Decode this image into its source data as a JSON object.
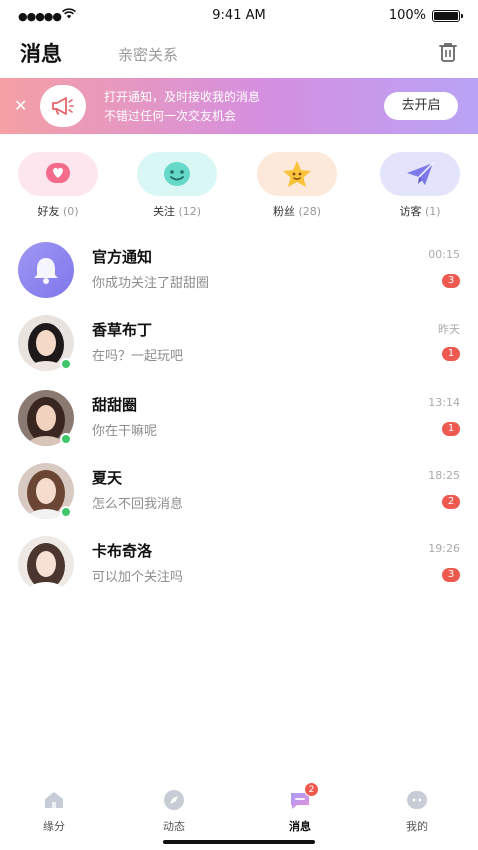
{
  "status_bar": {
    "time": "9:41 AM",
    "battery": "100%"
  },
  "header": {
    "active_tab": "消息",
    "inactive_tab": "亲密关系"
  },
  "banner": {
    "line1": "打开通知，及时接收我的消息",
    "line2": "不错过任何一次交友机会",
    "button": "去开启"
  },
  "shortcuts": [
    {
      "label": "好友",
      "count": "(0)",
      "icon": "heart-icon",
      "bg": "#fde6ee"
    },
    {
      "label": "关注",
      "count": "(12)",
      "icon": "smiley-icon",
      "bg": "#d8f7f5"
    },
    {
      "label": "粉丝",
      "count": "(28)",
      "icon": "star-icon",
      "bg": "#fde9d9"
    },
    {
      "label": "访客",
      "count": "(1)",
      "icon": "paper-plane-icon",
      "bg": "#e3e3fb"
    }
  ],
  "conversations": [
    {
      "name": "官方通知",
      "preview": "你成功关注了甜甜圈",
      "time": "00:15",
      "badge": "3",
      "online": false,
      "avatar": "bell-icon"
    },
    {
      "name": "香草布丁",
      "preview": "在吗？一起玩吧",
      "time": "昨天",
      "badge": "1",
      "online": true,
      "avatar": "user-photo"
    },
    {
      "name": "甜甜圈",
      "preview": "你在干嘛呢",
      "time": "13:14",
      "badge": "1",
      "online": true,
      "avatar": "user-photo"
    },
    {
      "name": "夏天",
      "preview": "怎么不回我消息",
      "time": "18:25",
      "badge": "2",
      "online": true,
      "avatar": "user-photo"
    },
    {
      "name": "卡布奇洛",
      "preview": "可以加个关注吗",
      "time": "19:26",
      "badge": "3",
      "online": false,
      "avatar": "user-photo"
    }
  ],
  "tabbar": {
    "items": [
      {
        "label": "缘分",
        "icon": "home-icon"
      },
      {
        "label": "动态",
        "icon": "compass-icon"
      },
      {
        "label": "消息",
        "icon": "message-icon",
        "badge": "2"
      },
      {
        "label": "我的",
        "icon": "profile-icon"
      }
    ]
  },
  "colors": {
    "badge": "#ee5a4f",
    "online": "#3fc56a",
    "accent": "#8f87f0"
  }
}
